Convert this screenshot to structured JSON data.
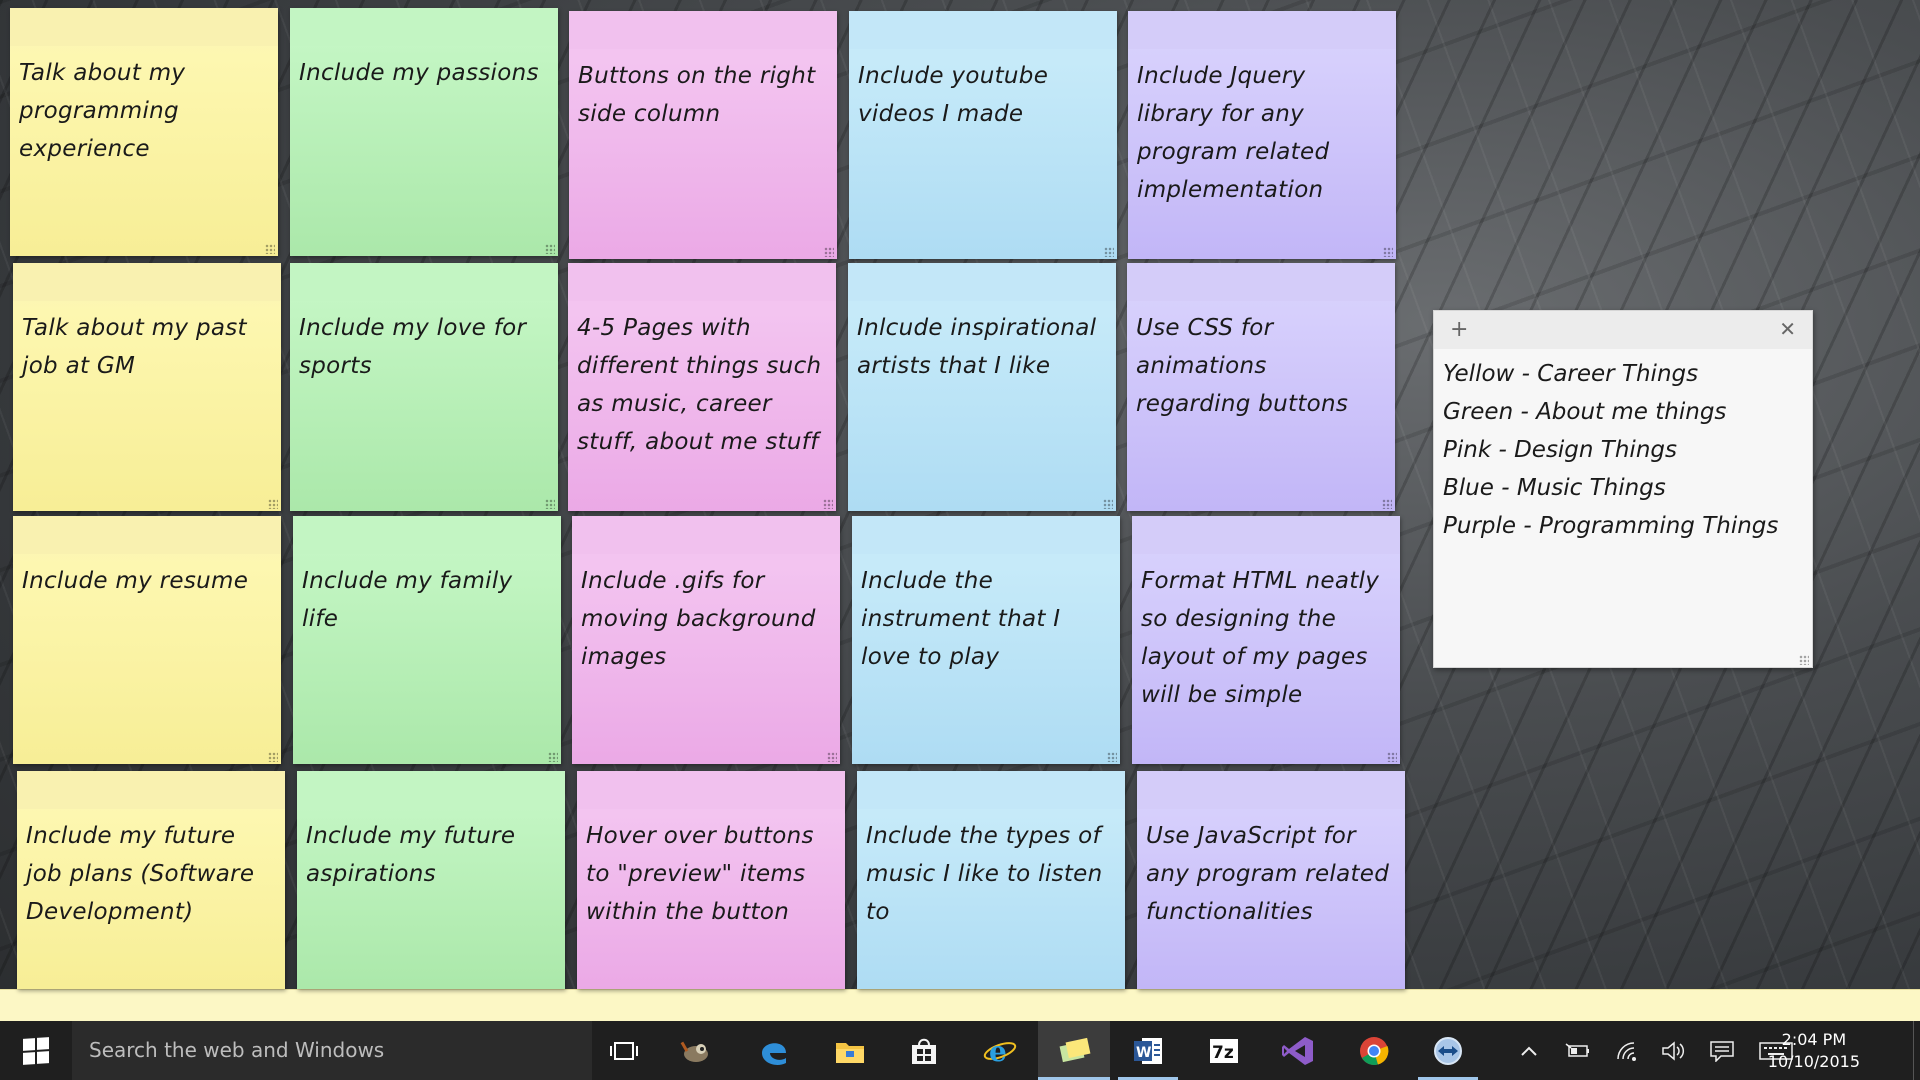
{
  "notes": [
    {
      "text": "Talk about my programming experience",
      "color": "yellow"
    },
    {
      "text": "Include my passions",
      "color": "green"
    },
    {
      "text": "Buttons on the right side column",
      "color": "pink"
    },
    {
      "text": "Include youtube videos I made",
      "color": "blue"
    },
    {
      "text": "Include Jquery library for any program related implementation",
      "color": "purple"
    },
    {
      "text": "Talk about my past job at GM",
      "color": "yellow"
    },
    {
      "text": "Include my love for sports",
      "color": "green"
    },
    {
      "text": "4-5 Pages with different things such as music, career stuff, about me stuff",
      "color": "pink"
    },
    {
      "text": "Inlcude inspirational artists that I like",
      "color": "blue"
    },
    {
      "text": "Use CSS for animations regarding buttons",
      "color": "purple"
    },
    {
      "text": "Include my resume",
      "color": "yellow"
    },
    {
      "text": "Include my family life",
      "color": "green"
    },
    {
      "text": "Include .gifs for moving background images",
      "color": "pink"
    },
    {
      "text": "Include the instrument that I love to play",
      "color": "blue"
    },
    {
      "text": "Format HTML neatly so designing the layout of my pages will be simple",
      "color": "purple"
    },
    {
      "text": "Include my future job plans (Software Development)",
      "color": "yellow"
    },
    {
      "text": "Include my future aspirations",
      "color": "green"
    },
    {
      "text": "Hover over buttons to \"preview\" items within the button",
      "color": "pink"
    },
    {
      "text": "Include the types of music I like to listen to",
      "color": "blue"
    },
    {
      "text": "Use JavaScript for any program related functionalities",
      "color": "purple"
    }
  ],
  "legend": {
    "add_label": "+",
    "close_label": "✕",
    "lines": [
      "Yellow - Career Things",
      "Green - About me things",
      "Pink - Design Things",
      "Blue - Music Things",
      "Purple - Programming Things"
    ]
  },
  "taskbar": {
    "search_placeholder": "Search the web and Windows",
    "apps": [
      "task-view",
      "gimp",
      "edge",
      "file-explorer",
      "store",
      "internet-explorer",
      "sticky-notes",
      "word",
      "7zip",
      "visual-studio",
      "chrome",
      "teamviewer"
    ],
    "time": "2:04 PM",
    "date": "10/10/2015"
  }
}
